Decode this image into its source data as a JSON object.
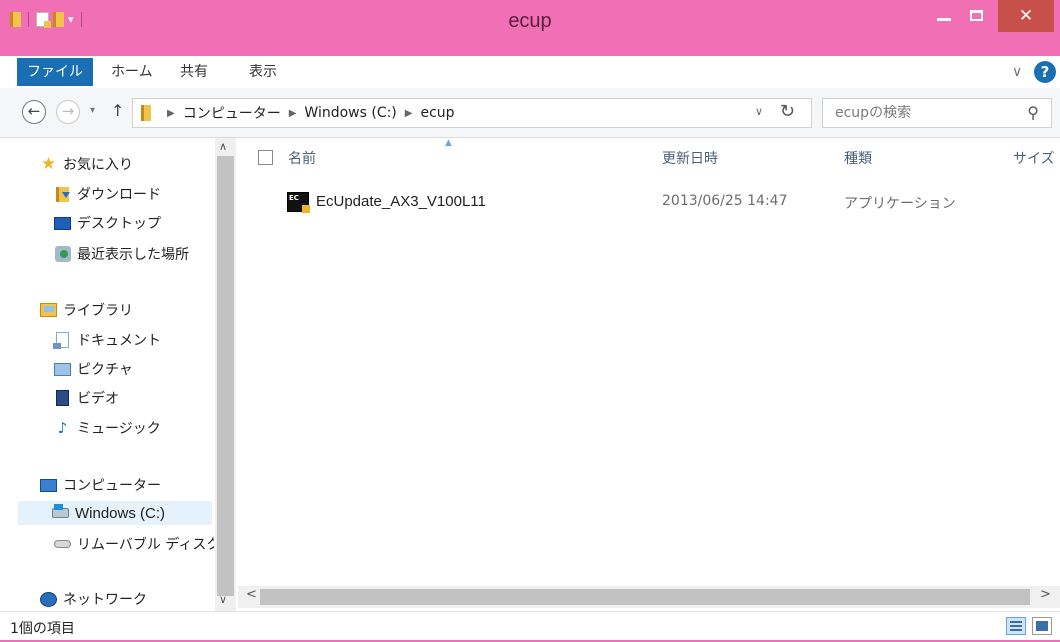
{
  "window": {
    "title": "ecup",
    "minimize_label": "",
    "maximize_label": "",
    "close_label": "✕"
  },
  "ribbon": {
    "tabs": [
      {
        "label": "ファイル"
      },
      {
        "label": "ホーム"
      },
      {
        "label": "共有"
      },
      {
        "label": "表示"
      }
    ],
    "expand_icon": "chevron-down-icon",
    "help_label": "?"
  },
  "address": {
    "breadcrumbs": [
      "コンピューター",
      "Windows (C:)",
      "ecup"
    ],
    "refresh_icon": "refresh-icon"
  },
  "search": {
    "placeholder": "ecupの検索"
  },
  "nav_pane": {
    "items": [
      {
        "label": "お気に入り",
        "icon": "star-icon"
      },
      {
        "label": "ダウンロード",
        "icon": "downloads-folder-icon"
      },
      {
        "label": "デスクトップ",
        "icon": "desktop-icon"
      },
      {
        "label": "最近表示した場所",
        "icon": "recent-places-icon"
      },
      {
        "label": "ライブラリ",
        "icon": "libraries-icon"
      },
      {
        "label": "ドキュメント",
        "icon": "documents-icon"
      },
      {
        "label": "ピクチャ",
        "icon": "pictures-icon"
      },
      {
        "label": "ビデオ",
        "icon": "videos-icon"
      },
      {
        "label": "ミュージック",
        "icon": "music-icon"
      },
      {
        "label": "コンピューター",
        "icon": "computer-icon"
      },
      {
        "label": "Windows (C:)",
        "icon": "drive-icon",
        "selected": true
      },
      {
        "label": "リムーバブル ディスク",
        "icon": "removable-disk-icon"
      },
      {
        "label": "ネットワーク",
        "icon": "network-icon"
      }
    ]
  },
  "file_list": {
    "columns": [
      "名前",
      "更新日時",
      "種類",
      "サイズ"
    ],
    "rows": [
      {
        "name": "EcUpdate_AX3_V100L11",
        "modified": "2013/06/25 14:47",
        "type": "アプリケーション",
        "icon": "application-icon",
        "icon_text": "EC"
      }
    ]
  },
  "status_bar": {
    "item_count": "1個の項目"
  },
  "colors": {
    "title_bar": "#f16fb4",
    "file_tab": "#1a6fb3",
    "close_button": "#c7514a",
    "selection": "#e5f1fb"
  }
}
